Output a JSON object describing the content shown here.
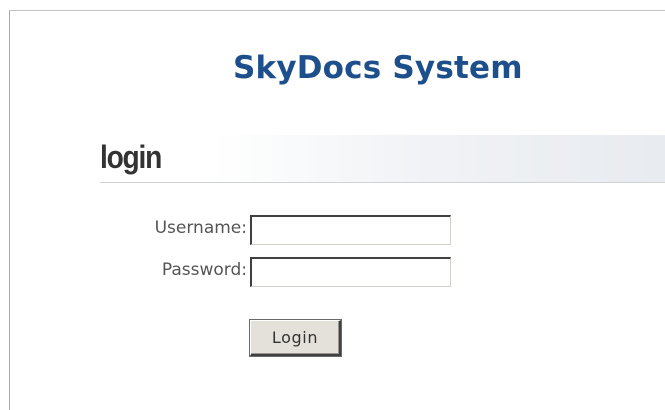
{
  "header": {
    "site_title": "SkyDocs System"
  },
  "login_section": {
    "heading": "login"
  },
  "form": {
    "username_label": "Username:",
    "username_value": "",
    "password_label": "Password:",
    "password_value": "",
    "submit_label": "Login"
  }
}
